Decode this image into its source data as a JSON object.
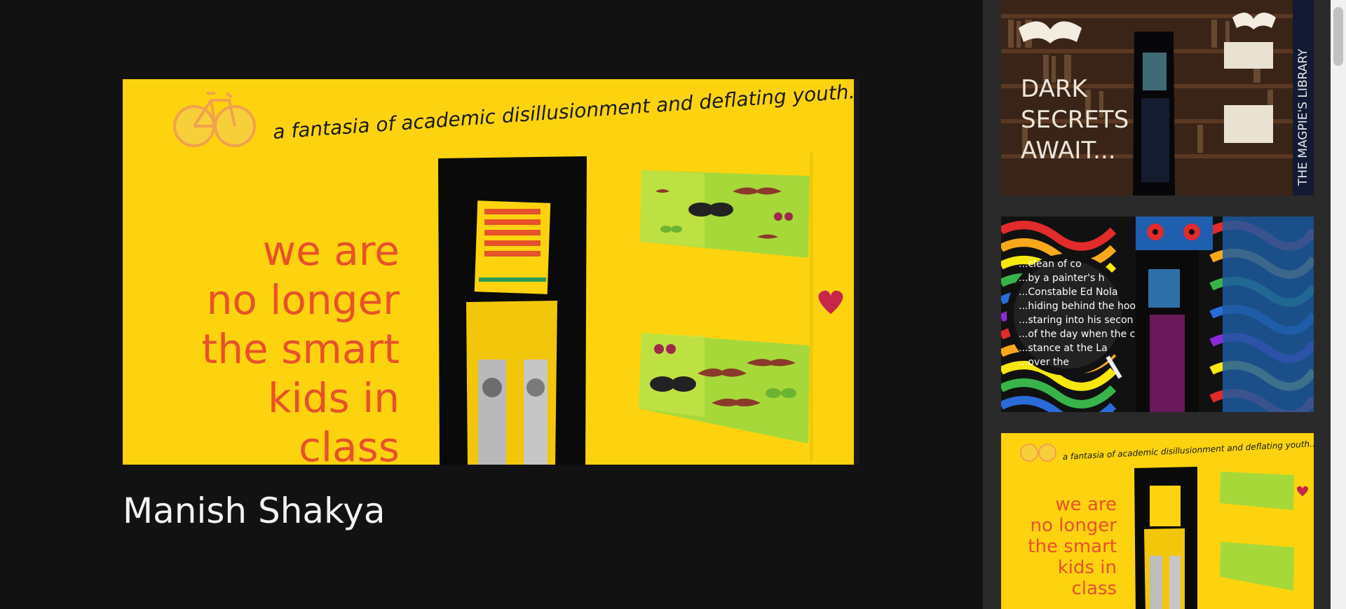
{
  "main": {
    "hero_tagline": "a fantasia of academic disillusionment and deflating youth...",
    "hero_poster_lines": [
      "we are",
      "no longer",
      "the smart",
      "kids in",
      "class"
    ],
    "artist_name": "Manish Shakya"
  },
  "sidebar": {
    "thumb_1": {
      "text_lines": [
        "DARK",
        "SECRETS",
        "AWAIT..."
      ],
      "banner": "THE MAGPIE'S LIBRARY"
    },
    "thumb_2": {
      "text_lines": [
        "...clean of co",
        "...by a painter's h",
        "...Constable Ed Nola",
        "...hiding behind the hoo",
        "...staring into his secon",
        "...of the day when the c",
        "...stance at the La",
        "...over the"
      ]
    },
    "thumb_3": {
      "tagline": "a fantasia of academic disillusionment and deflating youth...",
      "poster_lines": [
        "we are",
        "no longer",
        "the smart",
        "kids in",
        "class"
      ]
    }
  },
  "colors": {
    "background": "#121212",
    "sidebar": "#2a2a2a",
    "poster_yellow": "#fdd30f",
    "poster_text_orange": "#e8512a"
  }
}
